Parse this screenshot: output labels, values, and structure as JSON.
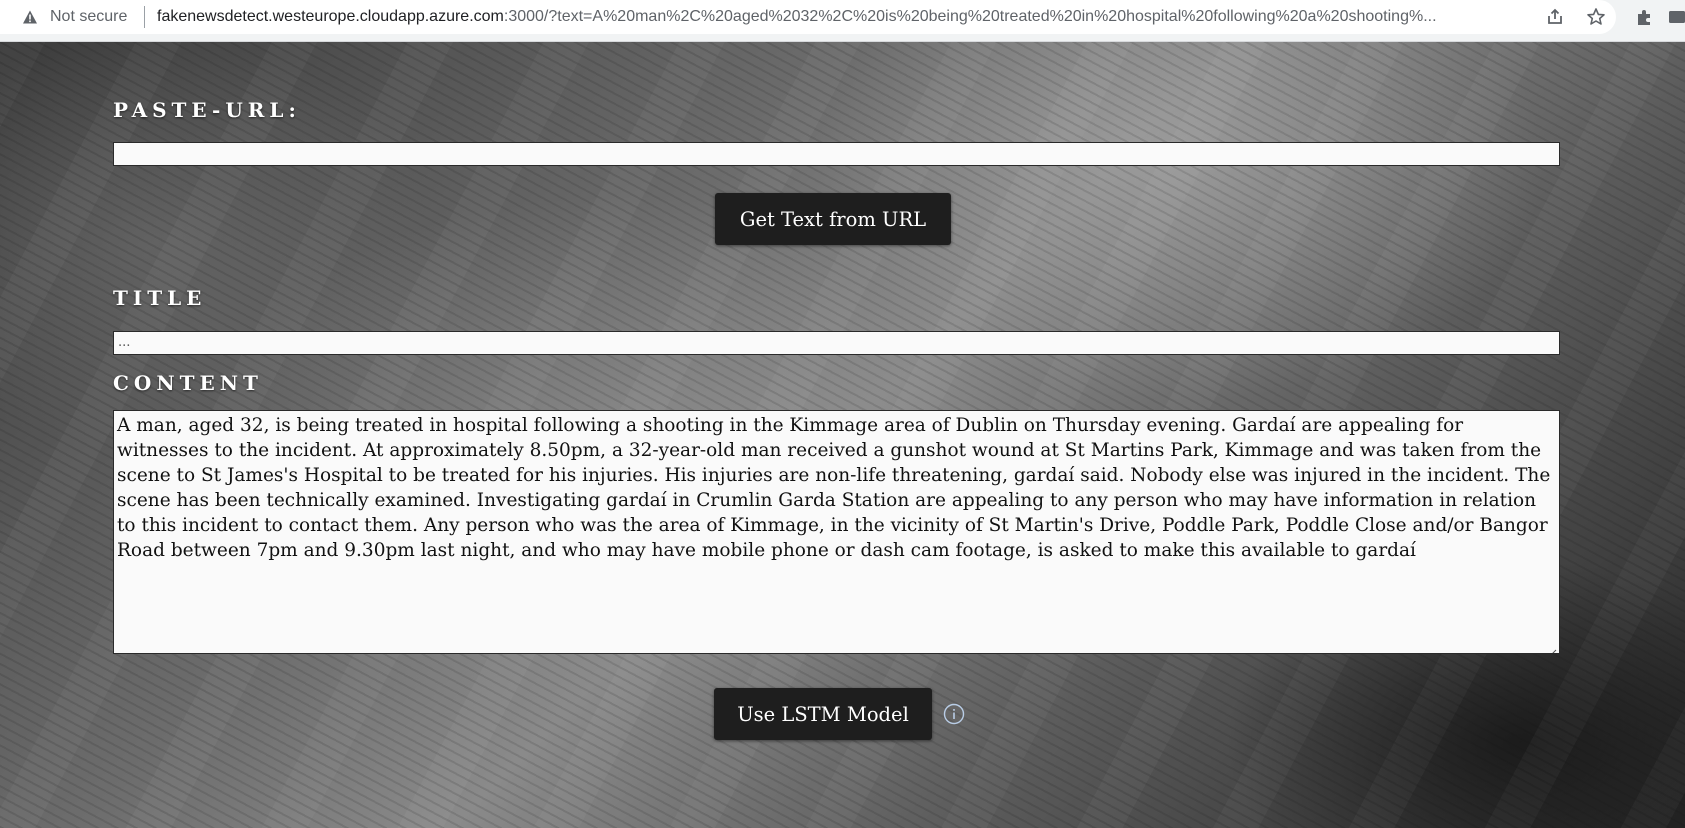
{
  "browser": {
    "security_label": "Not secure",
    "url_host": "fakenewsdetect.westeurope.cloudapp.azure.com",
    "url_rest": ":3000/?text=A%20man%2C%20aged%2032%2C%20is%20being%20treated%20in%20hospital%20following%20a%20shooting%...",
    "icons": [
      "warning-icon",
      "share-icon",
      "star-icon",
      "extensions-icon",
      "window-icon"
    ]
  },
  "form": {
    "paste_url_label": "PASTE-URL:",
    "paste_url_value": "",
    "get_text_button": "Get Text from URL",
    "title_label": "TITLE",
    "title_value": "...",
    "content_label": "CONTENT",
    "content_value": "A man, aged 32, is being treated in hospital following a shooting in the Kimmage area of Dublin on Thursday evening.  Gardaí are appealing for witnesses to the incident.  At approximately 8.50pm, a 32-year-old man received a gunshot wound at St Martins Park, Kimmage and was taken from the scene to St James's Hospital to be treated for his injuries. His injuries are non-life threatening, gardaí said.  Nobody else was injured in the incident. The scene has been technically examined.  Investigating gardaí in Crumlin Garda Station are appealing to any person who may have information in relation to this incident to contact them.  Any person who was the area of Kimmage, in the vicinity of St Martin's Drive, Poddle Park, Poddle Close and/or Bangor Road between 7pm and 9.30pm last night, and who may have mobile phone or dash cam footage, is asked to make this available to gardaí",
    "model_button": "Use LSTM Model",
    "info_icon": "info-icon"
  },
  "colors": {
    "button_bg": "#1e1e1e",
    "label_text": "#ffffff",
    "chrome_bg": "#f1f3f4"
  }
}
